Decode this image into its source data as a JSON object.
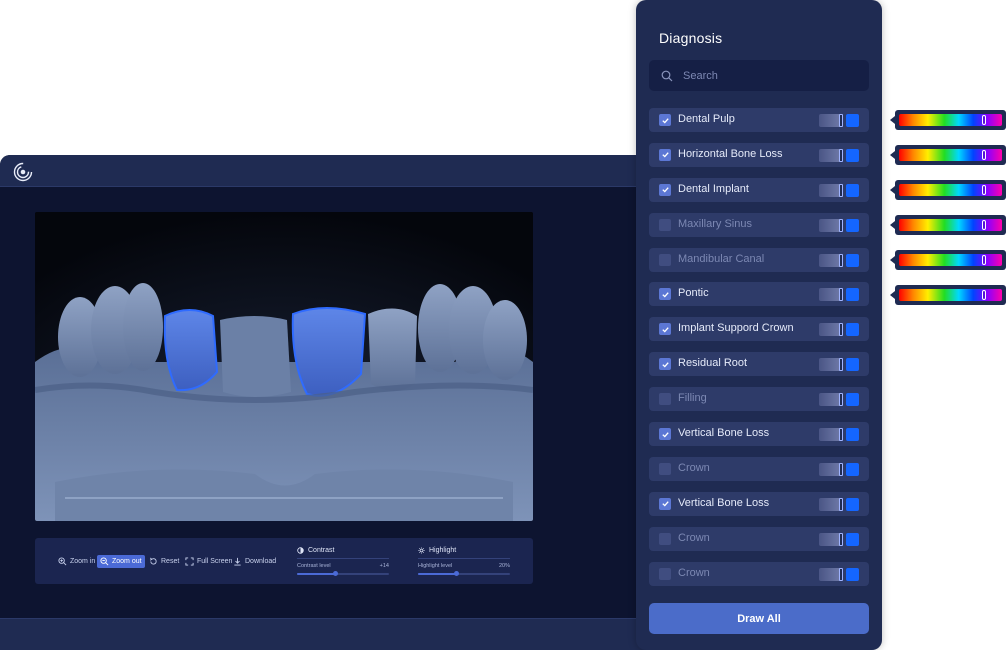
{
  "panel": {
    "title": "Diagnosis",
    "search_placeholder": "Search",
    "draw_all_label": "Draw All",
    "toggle_swatch_color": "#1466ff",
    "items": [
      {
        "label": "Dental Pulp",
        "checked": true
      },
      {
        "label": "Horizontal Bone Loss",
        "checked": true
      },
      {
        "label": "Dental Implant",
        "checked": true
      },
      {
        "label": "Maxillary Sinus",
        "checked": false
      },
      {
        "label": "Mandibular Canal",
        "checked": false
      },
      {
        "label": "Pontic",
        "checked": true
      },
      {
        "label": "Implant Suppord Crown",
        "checked": true
      },
      {
        "label": "Residual Root",
        "checked": true
      },
      {
        "label": "Filling",
        "checked": false
      },
      {
        "label": "Vertical Bone Loss",
        "checked": true
      },
      {
        "label": "Crown",
        "checked": false
      },
      {
        "label": "Vertical Bone Loss",
        "checked": true
      },
      {
        "label": "Crown",
        "checked": false
      },
      {
        "label": "Crown",
        "checked": false
      }
    ]
  },
  "color_pickers": [
    {
      "hue_fraction": 0.83
    },
    {
      "hue_fraction": 0.83
    },
    {
      "hue_fraction": 0.83
    },
    {
      "hue_fraction": 0.83
    },
    {
      "hue_fraction": 0.83
    },
    {
      "hue_fraction": 0.83
    }
  ],
  "toolbar": {
    "zoom_in": "Zoom in",
    "zoom_out": "Zoom out",
    "reset": "Reset",
    "full_screen": "Full Screen",
    "download": "Download",
    "contrast": {
      "title": "Contrast",
      "label": "Contrast level",
      "value": "+14",
      "fraction": 0.42
    },
    "highlight": {
      "title": "Highlight",
      "label": "Highlight level",
      "value": "20%",
      "fraction": 0.42
    }
  },
  "icons": {
    "logo": "scan-logo-icon",
    "search": "search-icon",
    "zoom_in": "zoom-in-icon",
    "zoom_out": "zoom-out-icon",
    "reset": "reset-icon",
    "full_screen": "full-screen-icon",
    "download": "download-icon",
    "contrast": "contrast-icon",
    "highlight": "sun-icon",
    "check": "check-icon"
  },
  "colors": {
    "panel_bg": "#1f2b52",
    "viewer_bg": "#0d1430",
    "accent": "#4b6cc9",
    "highlight_outline": "#2f6bff"
  }
}
